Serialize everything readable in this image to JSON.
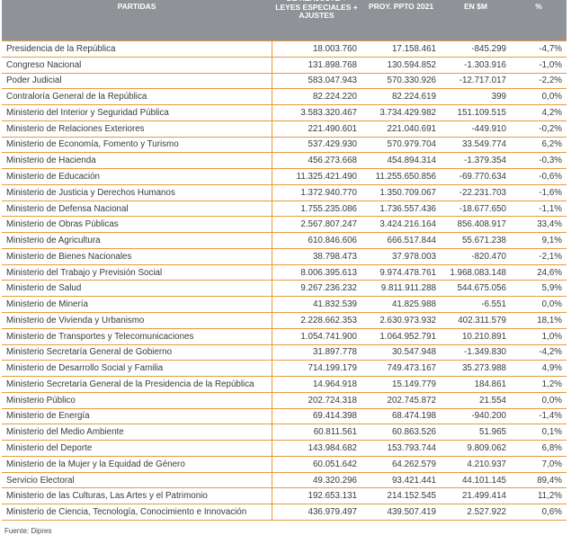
{
  "table": {
    "headers": [
      "PARTIDAS",
      "DE REAJUSTE + LEYES ESPECIALES + AJUSTES",
      "PROY. PPTO 2021",
      "EN $M",
      "%"
    ],
    "rows": [
      [
        "Presidencia de la República",
        "18.003.760",
        "17.158.461",
        "-845.299",
        "-4,7%"
      ],
      [
        "Congreso Nacional",
        "131.898.768",
        "130.594.852",
        "-1.303.916",
        "-1,0%"
      ],
      [
        "Poder Judicial",
        "583.047.943",
        "570.330.926",
        "-12.717.017",
        "-2,2%"
      ],
      [
        "Contraloría General de la República",
        "82.224.220",
        "82.224.619",
        "399",
        "0,0%"
      ],
      [
        "Ministerio del Interior y Seguridad Pública",
        "3.583.320.467",
        "3.734.429.982",
        "151.109.515",
        "4,2%"
      ],
      [
        "Ministerio de Relaciones Exteriores",
        "221.490.601",
        "221.040.691",
        "-449.910",
        "-0,2%"
      ],
      [
        "Ministerio de Economía, Fomento y Turismo",
        "537.429.930",
        "570.979.704",
        "33.549.774",
        "6,2%"
      ],
      [
        "Ministerio de Hacienda",
        "456.273.668",
        "454.894.314",
        "-1.379.354",
        "-0,3%"
      ],
      [
        "Ministerio de Educación",
        "11.325.421.490",
        "11.255.650.856",
        "-69.770.634",
        "-0,6%"
      ],
      [
        "Ministerio de Justicia y Derechos Humanos",
        "1.372.940.770",
        "1.350.709.067",
        "-22.231.703",
        "-1,6%"
      ],
      [
        "Ministerio de Defensa Nacional",
        "1.755.235.086",
        "1.736.557.436",
        "-18.677.650",
        "-1,1%"
      ],
      [
        "Ministerio de Obras Públicas",
        "2.567.807.247",
        "3.424.216.164",
        "856.408.917",
        "33,4%"
      ],
      [
        "Ministerio de Agricultura",
        "610.846.606",
        "666.517.844",
        "55.671.238",
        "9,1%"
      ],
      [
        "Ministerio de Bienes Nacionales",
        "38.798.473",
        "37.978.003",
        "-820.470",
        "-2,1%"
      ],
      [
        "Ministerio del Trabajo y Previsión Social",
        "8.006.395.613",
        "9.974.478.761",
        "1.968.083.148",
        "24,6%"
      ],
      [
        "Ministerio de Salud",
        "9.267.236.232",
        "9.811.911.288",
        "544.675.056",
        "5,9%"
      ],
      [
        "Ministerio de Minería",
        "41.832.539",
        "41.825.988",
        "-6.551",
        "0,0%"
      ],
      [
        "Ministerio de Vivienda y Urbanismo",
        "2.228.662.353",
        "2.630.973.932",
        "402.311.579",
        "18,1%"
      ],
      [
        "Ministerio de Transportes y Telecomunicaciones",
        "1.054.741.900",
        "1.064.952.791",
        "10.210.891",
        "1,0%"
      ],
      [
        "Ministerio Secretaría General de Gobierno",
        "31.897.778",
        "30.547.948",
        "-1.349.830",
        "-4,2%"
      ],
      [
        "Ministerio de Desarrollo Social y Familia",
        "714.199.179",
        "749.473.167",
        "35.273.988",
        "4,9%"
      ],
      [
        "Ministerio Secretaría General de la Presidencia de la República",
        "14.964.918",
        "15.149.779",
        "184.861",
        "1,2%"
      ],
      [
        "Ministerio Público",
        "202.724.318",
        "202.745.872",
        "21.554",
        "0,0%"
      ],
      [
        "Ministerio de Energía",
        "69.414.398",
        "68.474.198",
        "-940.200",
        "-1,4%"
      ],
      [
        "Ministerio del Medio Ambiente",
        "60.811.561",
        "60.863.526",
        "51.965",
        "0,1%"
      ],
      [
        "Ministerio del Deporte",
        "143.984.682",
        "153.793.744",
        "9.809.062",
        "6,8%"
      ],
      [
        "Ministerio de la Mujer y la Equidad de Género",
        "60.051.642",
        "64.262.579",
        "4.210.937",
        "7,0%"
      ],
      [
        "Servicio Electoral",
        "49.320.296",
        "93.421.441",
        "44.101.145",
        "89,4%"
      ],
      [
        "Ministerio de las Culturas, Las Artes y el Patrimonio",
        "192.653.131",
        "214.152.545",
        "21.499.414",
        "11,2%"
      ],
      [
        "Ministerio de Ciencia, Tecnología, Conocimiento e Innovación",
        "436.979.497",
        "439.507.419",
        "2.527.922",
        "0,6%"
      ]
    ]
  },
  "source": "Fuente: Dipres"
}
